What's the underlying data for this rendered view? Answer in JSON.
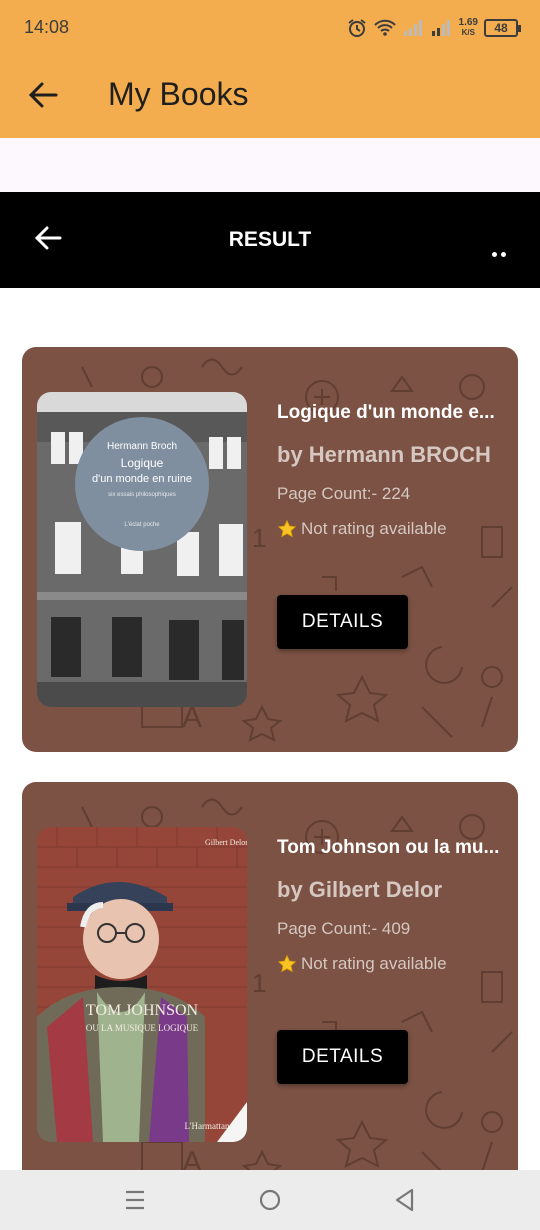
{
  "status_bar": {
    "time": "14:08",
    "net_speed_value": "1.69",
    "net_speed_unit": "K/S",
    "battery": "48",
    "icons": [
      "alarm-icon",
      "wifi-icon",
      "signal-icon",
      "signal-icon",
      "battery-icon"
    ]
  },
  "app_bar": {
    "title": "My Books",
    "back_icon": "arrow-left-icon",
    "background": "#f3ad4e"
  },
  "result_bar": {
    "title": "RESULT",
    "back_icon": "arrow-left-icon",
    "menu_icon": "more-dots-icon",
    "background": "#000000"
  },
  "books": [
    {
      "title": "Logique d'un monde e...",
      "author": "by Hermann BROCH",
      "page_count": "Page Count:- 224",
      "rating": "Not rating available",
      "button": "DETAILS",
      "cover": {
        "author": "Hermann Broch",
        "title_line1": "Logique",
        "title_line2": "d'un monde en ruine",
        "subtitle": "six essais philosophiques",
        "publisher": "L'éclat poche"
      }
    },
    {
      "title": "Tom Johnson ou la mu...",
      "author": "by Gilbert Delor",
      "page_count": "Page Count:- 409",
      "rating": "Not rating available",
      "button": "DETAILS",
      "cover": {
        "author": "Gilbert Delor",
        "title_line1": "TOM JOHNSON",
        "title_line2": "OU LA MUSIQUE LOGIQUE",
        "publisher": "L'Harmattan"
      }
    }
  ],
  "colors": {
    "card": "#7b5244",
    "accent": "#f3ad4e",
    "muted_text": "#d6c7c1"
  },
  "nav_bar": {
    "icons": [
      "menu-icon",
      "home-icon",
      "back-icon"
    ]
  }
}
